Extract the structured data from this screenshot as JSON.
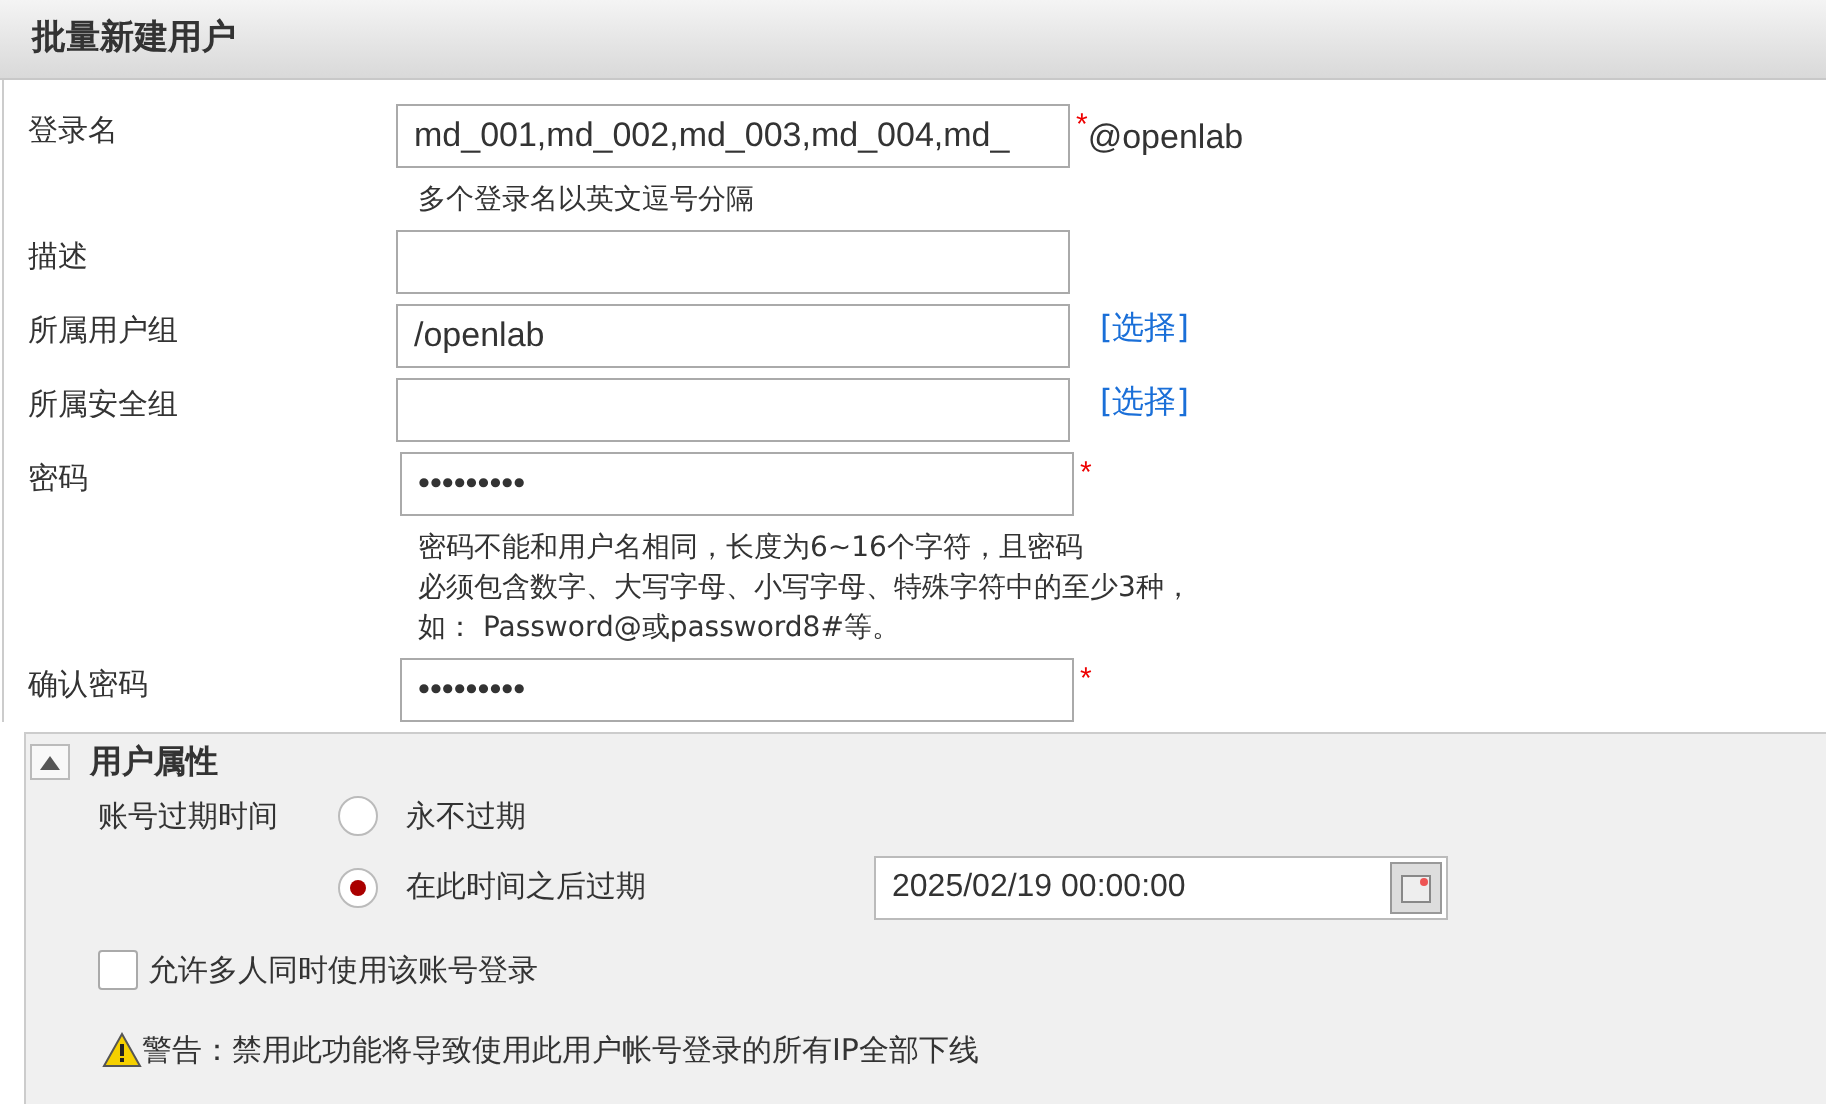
{
  "window": {
    "title": "批量新建用户"
  },
  "form": {
    "rows": [
      {
        "label": "登录名",
        "value": "md_001,md_002,md_003,md_004,md_",
        "required_mark": "*",
        "suffix": "@openlab",
        "hints": [
          "多个登录名以英文逗号分隔"
        ]
      },
      {
        "label": "描述",
        "value": ""
      },
      {
        "label": "所属用户组",
        "value": "/openlab",
        "link": "[选择]"
      },
      {
        "label": "所属安全组",
        "value": "",
        "link": "[选择]"
      },
      {
        "label": "密码",
        "value": "•••••••••",
        "required_mark": "*",
        "hints": [
          "密码不能和用户名相同，长度为6~16个字符，且密码",
          "必须包含数字、大写字母、小写字母、特殊字符中的至少3种，",
          "如： Password@或password8#等。"
        ]
      },
      {
        "label": "确认密码",
        "value": "•••••••••",
        "required_mark": "*"
      }
    ]
  },
  "user_attributes": {
    "title": "用户属性",
    "expanded": true,
    "expiry_label": "账号过期时间",
    "options": [
      {
        "label": "永不过期",
        "selected": false
      },
      {
        "label": "在此时间之后过期",
        "selected": true
      }
    ],
    "expiry_date": "2025/02/19 00:00:00",
    "multi_login": {
      "label": "允许多人同时使用该账号登录",
      "checked": false
    },
    "warning": "警告：禁用此功能将导致使用此用户帐号登录的所有IP全部下线"
  }
}
